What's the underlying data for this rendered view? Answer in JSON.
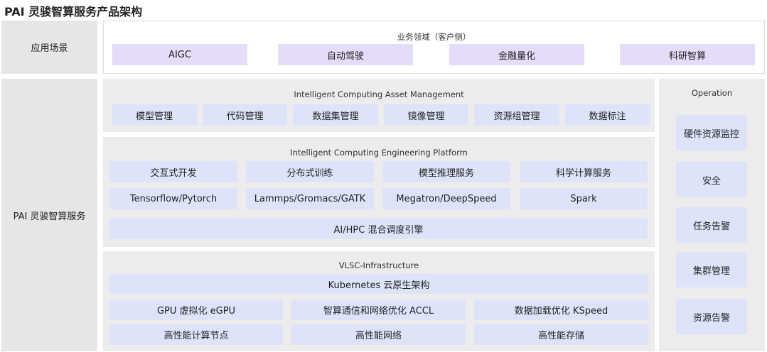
{
  "title": "PAI 灵骏智算服务产品架构",
  "app_scenarios": {
    "label": "应用场景",
    "header": "业务领域（客户侧）",
    "items": [
      "AIGC",
      "自动驾驶",
      "金融量化",
      "科研智算"
    ]
  },
  "service_label": "PAI 灵骏智算服务",
  "asset_management": {
    "header": "Intelligent Computing Asset Management",
    "items": [
      "模型管理",
      "代码管理",
      "数据集管理",
      "镜像管理",
      "资源组管理",
      "数据标注"
    ]
  },
  "engineering_platform": {
    "header": "Intelligent Computing Engineering Platform",
    "row1": [
      "交互式开发",
      "分布式训练",
      "模型推理服务",
      "科学计算服务"
    ],
    "row2": [
      "Tensorflow/Pytorch",
      "Lammps/Gromacs/GATK",
      "Megatron/DeepSpeed",
      "Spark"
    ],
    "scheduler": "AI/HPC 混合调度引擎"
  },
  "infrastructure": {
    "header": "VLSC-Infrastructure",
    "kubernetes": "Kubernetes 云原生架构",
    "row1": [
      "GPU 虚拟化 eGPU",
      "智算通信和网络优化 ACCL",
      "数据加载优化 KSpeed"
    ],
    "row2": [
      "高性能计算节点",
      "高性能网络",
      "高性能存储"
    ]
  },
  "operation": {
    "header": "Operation",
    "items": [
      "硬件资源监控",
      "安全",
      "任务告警",
      "集群管理",
      "资源告警"
    ]
  },
  "colors": {
    "left_label_bg": "#e6e6e6",
    "panel_bg": "#ececec",
    "box_blue": "#dfe3fa",
    "box_purple": "#e4dcf8"
  }
}
